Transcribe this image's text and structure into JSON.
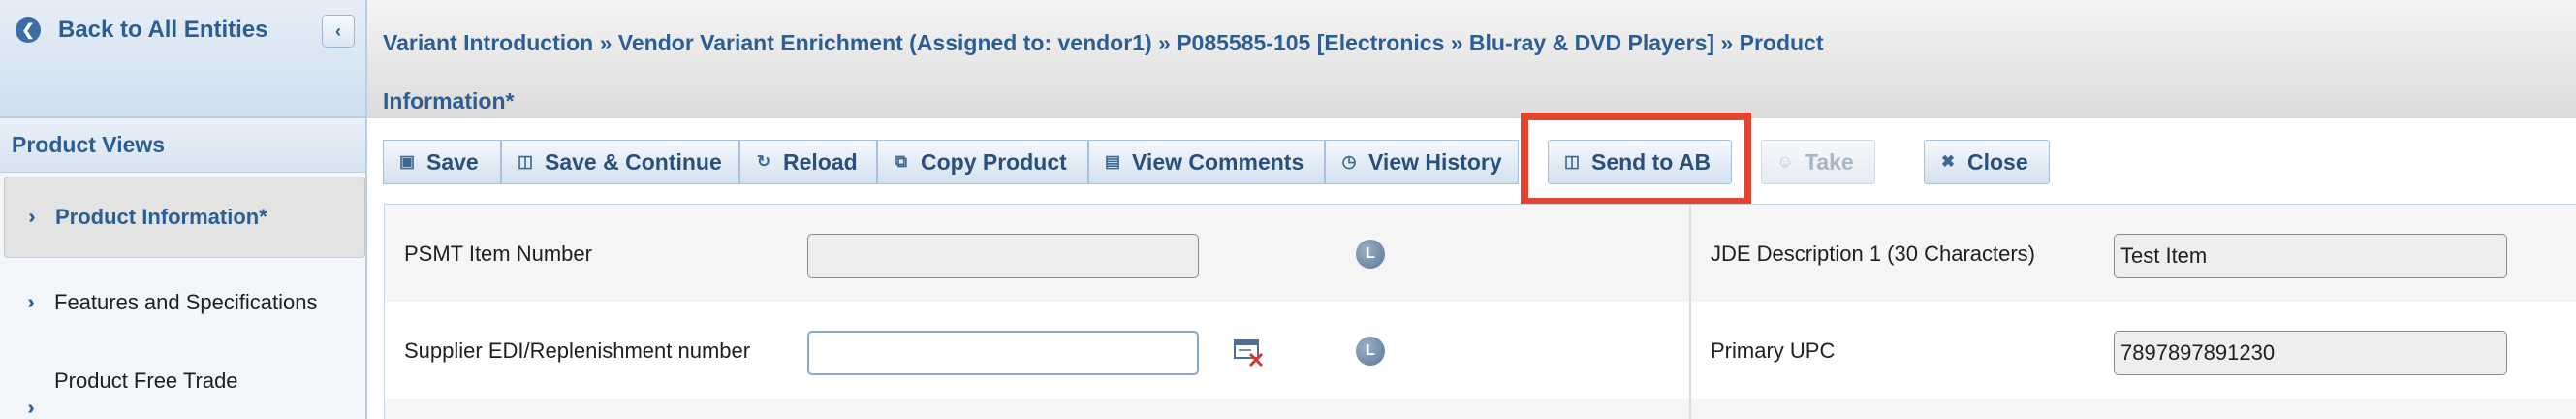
{
  "sidebar": {
    "back_label": "Back to All Entities",
    "collapse_glyph": "‹",
    "views_header": "Product Views",
    "items": [
      {
        "label": "Product Information*",
        "active": true
      },
      {
        "label": "Features and Specifications",
        "active": false
      },
      {
        "label": "Product Free Trade",
        "active": false
      }
    ]
  },
  "header": {
    "breadcrumb": "Variant Introduction » Vendor Variant Enrichment (Assigned to: vendor1) » P085585-105 [Electronics » Blu-ray & DVD Players] » Product Information*"
  },
  "toolbar": {
    "save": "Save",
    "save_continue": "Save & Continue",
    "reload": "Reload",
    "copy_product": "Copy Product",
    "view_comments": "View Comments",
    "view_history": "View History",
    "send_to_ab": "Send to AB",
    "take": "Take",
    "close": "Close"
  },
  "form": {
    "psmt_label": "PSMT Item Number",
    "psmt_value": "",
    "jde_label": "JDE Description 1 (30 Characters)",
    "jde_value": "Test Item",
    "edi_label": "Supplier EDI/Replenishment number",
    "edi_value": "",
    "upc_label": "Primary UPC",
    "upc_value": "7897897891230",
    "lock_letter": "L"
  },
  "icons": {
    "back": "back-arrow-icon",
    "collapse": "collapse-chevron-icon",
    "nav": "double-chevron-icon",
    "save": "floppy-icon",
    "save_continue": "book-icon",
    "reload": "reload-icon",
    "copy": "copy-icon",
    "comments": "comment-icon",
    "history": "clock-icon",
    "send": "book-icon",
    "take": "user-icon",
    "close": "x-icon",
    "lock": "lock-badge-icon",
    "edi": "edit-clear-icon"
  },
  "colors": {
    "accent": "#2c5d93",
    "highlight": "#e2452f"
  }
}
